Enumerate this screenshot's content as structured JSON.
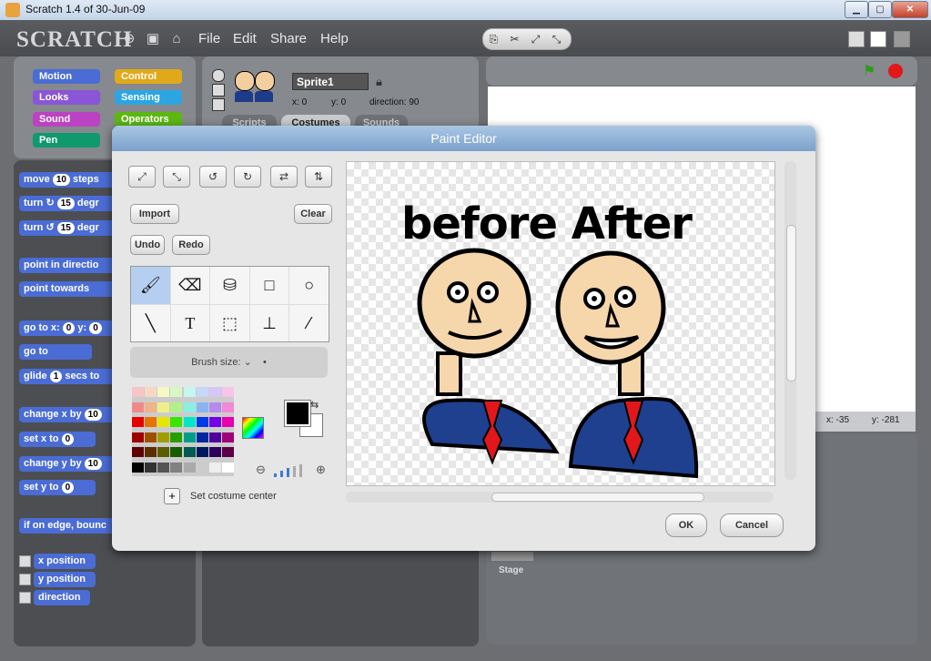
{
  "window": {
    "title": "Scratch 1.4 of 30-Jun-09"
  },
  "header": {
    "logo": "SCRATCH",
    "menus": [
      "File",
      "Edit",
      "Share",
      "Help"
    ]
  },
  "categories": [
    {
      "label": "Motion",
      "color": "#4a6cd4"
    },
    {
      "label": "Control",
      "color": "#e1a91a"
    },
    {
      "label": "Looks",
      "color": "#8a55d7"
    },
    {
      "label": "Sensing",
      "color": "#2ca5e2"
    },
    {
      "label": "Sound",
      "color": "#bb42c3"
    },
    {
      "label": "Operators",
      "color": "#5cb712"
    },
    {
      "label": "Pen",
      "color": "#0e9a6c"
    }
  ],
  "blocks": {
    "move": {
      "pre": "move",
      "num": "10",
      "post": "steps"
    },
    "turn_r": {
      "pre": "turn ↻",
      "num": "15",
      "post": "degr"
    },
    "turn_l": {
      "pre": "turn ↺",
      "num": "15",
      "post": "degr"
    },
    "point_dir": "point in directio",
    "point_towards": "point towards",
    "goto_xy": {
      "pre": "go to x:",
      "num": "0",
      "mid": "y:",
      "num2": "0"
    },
    "goto": "go to",
    "glide": {
      "pre": "glide",
      "num": "1",
      "post": "secs to"
    },
    "change_x": {
      "pre": "change x by",
      "num": "10"
    },
    "set_x": {
      "pre": "set x to",
      "num": "0"
    },
    "change_y": {
      "pre": "change y by",
      "num": "10"
    },
    "set_y": {
      "pre": "set y to",
      "num": "0"
    },
    "edge": "if on edge, bounc",
    "xpos": "x position",
    "ypos": "y position",
    "direction": "direction"
  },
  "sprite": {
    "name": "Sprite1",
    "x_label": "x:",
    "x": "0",
    "y_label": "y:",
    "y": "0",
    "dir_label": "direction:",
    "dir": "90",
    "tabs": [
      "Scripts",
      "Costumes",
      "Sounds"
    ]
  },
  "stage": {
    "x_readout": "x: -35",
    "y_readout": "y: -281",
    "stage_label": "Stage"
  },
  "paint_editor": {
    "title": "Paint Editor",
    "import": "Import",
    "clear": "Clear",
    "undo": "Undo",
    "redo": "Redo",
    "brush_size": "Brush size:",
    "set_center": "Set costume center",
    "ok": "OK",
    "cancel": "Cancel",
    "canvas_text": "before After",
    "palette": [
      "#f7c5c5",
      "#f7d8c5",
      "#f7f7c5",
      "#d8f7c5",
      "#c5f7f0",
      "#c5d8f7",
      "#d8c5f7",
      "#f7c5ea",
      "#ef8a8a",
      "#efb48a",
      "#efef8a",
      "#b4ef8a",
      "#8aefe2",
      "#8ab4ef",
      "#b48aef",
      "#ef8ad6",
      "#e60000",
      "#e67300",
      "#e6e600",
      "#39e600",
      "#00e6c7",
      "#0039e6",
      "#7300e6",
      "#e600ac",
      "#9e0000",
      "#9e4f00",
      "#9e9e00",
      "#279e00",
      "#009e89",
      "#00279e",
      "#4f009e",
      "#9e0076",
      "#5c0000",
      "#5c2e00",
      "#5c5c00",
      "#175c00",
      "#005c50",
      "#00175c",
      "#2e005c",
      "#5c0045",
      "#000000",
      "#333333",
      "#555555",
      "#808080",
      "#aaaaaa",
      "#cccccc",
      "#eeeeee",
      "#ffffff"
    ]
  }
}
